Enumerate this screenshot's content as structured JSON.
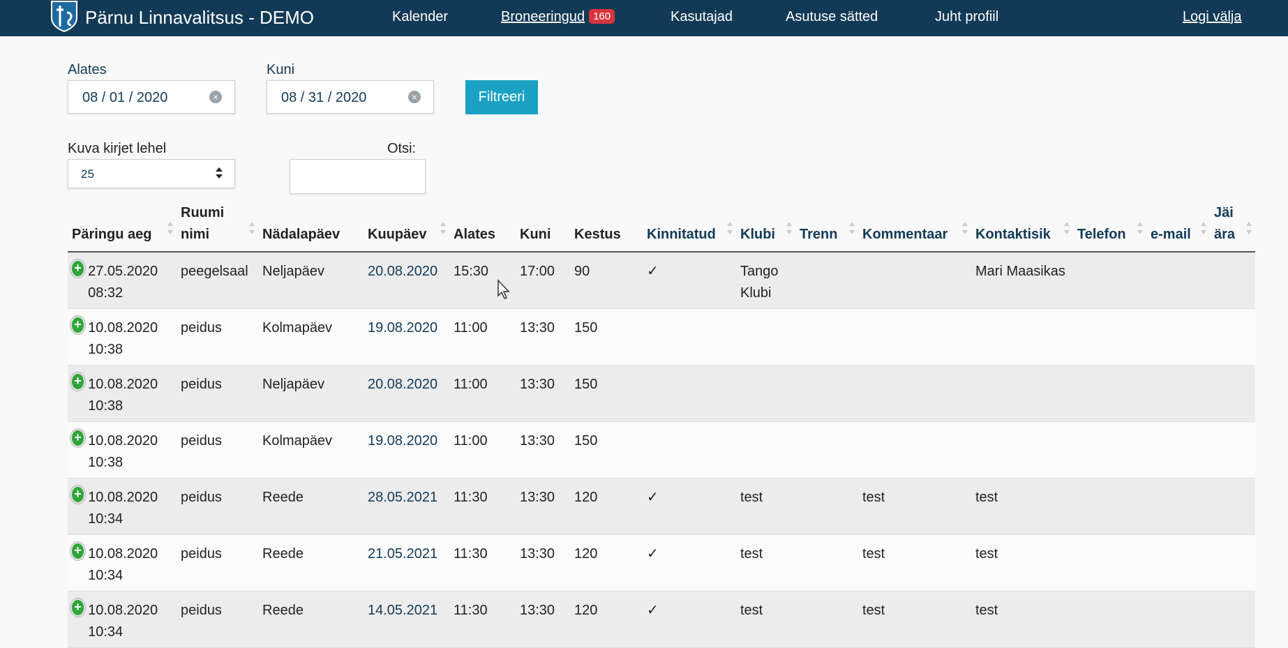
{
  "nav": {
    "brand": "Pärnu Linnavalitsus - DEMO",
    "items": [
      {
        "label": "Kalender"
      },
      {
        "label": "Broneeringud",
        "badge": "160"
      },
      {
        "label": "Kasutajad"
      },
      {
        "label": "Asutuse sätted"
      },
      {
        "label": "Juht profiil"
      }
    ],
    "logout": "Logi välja"
  },
  "filter": {
    "from_label": "Alates",
    "from_value": "08 / 01 / 2020",
    "to_label": "Kuni",
    "to_value": "08 / 31 / 2020",
    "button": "Filtreeri"
  },
  "list_controls": {
    "per_page_label": "Kuva kirjet lehel",
    "per_page_value": "25",
    "search_label": "Otsi:",
    "search_value": ""
  },
  "table": {
    "headers": {
      "request_time": "Päringu aeg",
      "room_name": "Ruumi nimi",
      "weekday": "Nädalapäev",
      "date": "Kuupäev",
      "start": "Alates",
      "end": "Kuni",
      "duration": "Kestus",
      "confirmed": "Kinnitatud",
      "club": "Klubi",
      "training": "Trenn",
      "comment": "Kommentaar",
      "contact": "Kontaktisik",
      "phone": "Telefon",
      "email": "e-mail",
      "cancelled": "Jäi ära"
    },
    "rows": [
      {
        "request_time": "27.05.2020 08:32",
        "room": "peegelsaal",
        "weekday": "Neljapäev",
        "date": "20.08.2020",
        "start": "15:30",
        "end": "17:00",
        "duration": "90",
        "confirmed": "✓",
        "club": "Tango Klubi",
        "training": "",
        "comment": "",
        "contact": "Mari Maasikas",
        "phone": "",
        "email": "",
        "cancelled": ""
      },
      {
        "request_time": "10.08.2020 10:38",
        "room": "peidus",
        "weekday": "Kolmapäev",
        "date": "19.08.2020",
        "start": "11:00",
        "end": "13:30",
        "duration": "150",
        "confirmed": "",
        "club": "",
        "training": "",
        "comment": "",
        "contact": "",
        "phone": "",
        "email": "",
        "cancelled": ""
      },
      {
        "request_time": "10.08.2020 10:38",
        "room": "peidus",
        "weekday": "Neljapäev",
        "date": "20.08.2020",
        "start": "11:00",
        "end": "13:30",
        "duration": "150",
        "confirmed": "",
        "club": "",
        "training": "",
        "comment": "",
        "contact": "",
        "phone": "",
        "email": "",
        "cancelled": ""
      },
      {
        "request_time": "10.08.2020 10:38",
        "room": "peidus",
        "weekday": "Kolmapäev",
        "date": "19.08.2020",
        "start": "11:00",
        "end": "13:30",
        "duration": "150",
        "confirmed": "",
        "club": "",
        "training": "",
        "comment": "",
        "contact": "",
        "phone": "",
        "email": "",
        "cancelled": ""
      },
      {
        "request_time": "10.08.2020 10:34",
        "room": "peidus",
        "weekday": "Reede",
        "date": "28.05.2021",
        "start": "11:30",
        "end": "13:30",
        "duration": "120",
        "confirmed": "✓",
        "club": "test",
        "training": "",
        "comment": "test",
        "contact": "test",
        "phone": "",
        "email": "",
        "cancelled": ""
      },
      {
        "request_time": "10.08.2020 10:34",
        "room": "peidus",
        "weekday": "Reede",
        "date": "21.05.2021",
        "start": "11:30",
        "end": "13:30",
        "duration": "120",
        "confirmed": "✓",
        "club": "test",
        "training": "",
        "comment": "test",
        "contact": "test",
        "phone": "",
        "email": "",
        "cancelled": ""
      },
      {
        "request_time": "10.08.2020 10:34",
        "room": "peidus",
        "weekday": "Reede",
        "date": "14.05.2021",
        "start": "11:30",
        "end": "13:30",
        "duration": "120",
        "confirmed": "✓",
        "club": "test",
        "training": "",
        "comment": "test",
        "contact": "test",
        "phone": "",
        "email": "",
        "cancelled": ""
      }
    ]
  },
  "icons": {
    "logo": "city-crest-icon",
    "row_expand": "plus-circle-icon",
    "sort": "sort-arrows-icon",
    "clear": "clear-circle-icon",
    "cursor": "mouse-pointer-icon"
  },
  "colors": {
    "navbar": "#123a56",
    "badge": "#d9343d",
    "button": "#1ba1c4",
    "expand": "#2fa53a"
  }
}
